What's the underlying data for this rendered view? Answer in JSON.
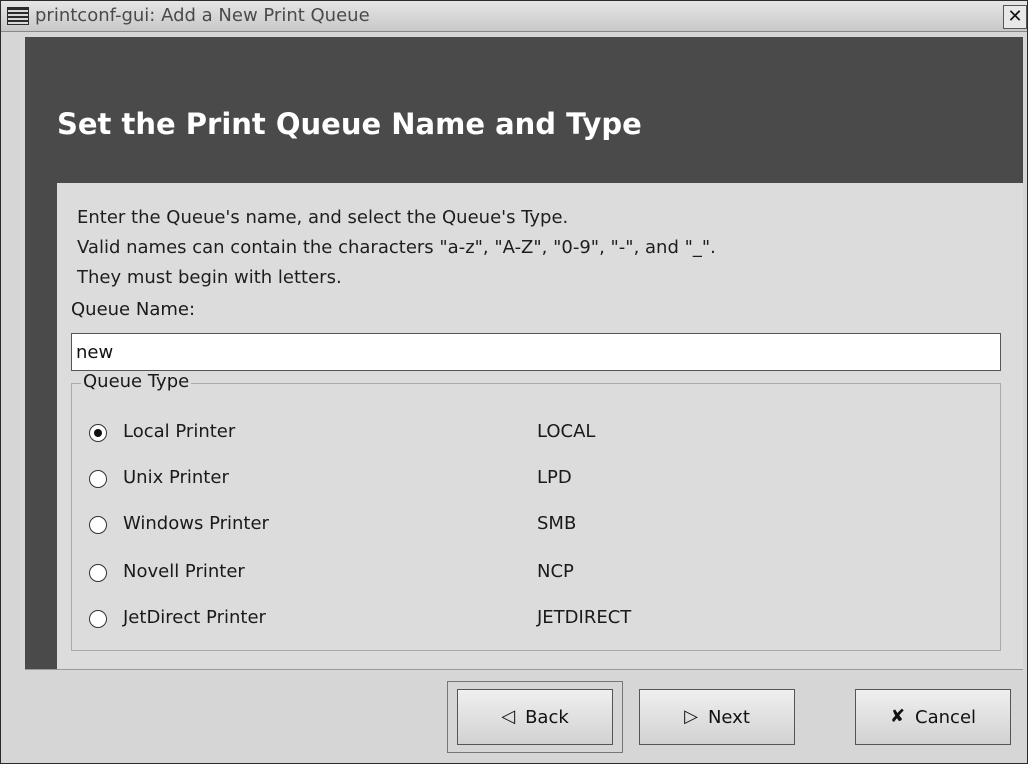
{
  "window": {
    "title": "printconf-gui: Add a New Print Queue",
    "close_glyph": "✕"
  },
  "banner": {
    "title": "Set the Print Queue Name and Type"
  },
  "instructions": [
    "Enter the Queue's name, and select the Queue's Type.",
    "Valid names can contain the characters \"a-z\", \"A-Z\", \"0-9\", \"-\", and \"_\".",
    "They must begin with letters."
  ],
  "queue_name": {
    "label": "Queue Name:",
    "value": "new"
  },
  "queue_type": {
    "legend": "Queue Type",
    "options": [
      {
        "label": "Local Printer",
        "code": "LOCAL",
        "checked": true
      },
      {
        "label": "Unix Printer",
        "code": "LPD",
        "checked": false
      },
      {
        "label": "Windows Printer",
        "code": "SMB",
        "checked": false
      },
      {
        "label": "Novell Printer",
        "code": "NCP",
        "checked": false
      },
      {
        "label": "JetDirect Printer",
        "code": "JETDIRECT",
        "checked": false
      }
    ]
  },
  "buttons": {
    "back": {
      "label": "Back",
      "icon": "left-triangle-icon",
      "glyph": "◁"
    },
    "next": {
      "label": "Next",
      "icon": "right-triangle-icon",
      "glyph": "▷"
    },
    "cancel": {
      "label": "Cancel",
      "icon": "cancel-x-icon",
      "glyph": "✘"
    }
  }
}
